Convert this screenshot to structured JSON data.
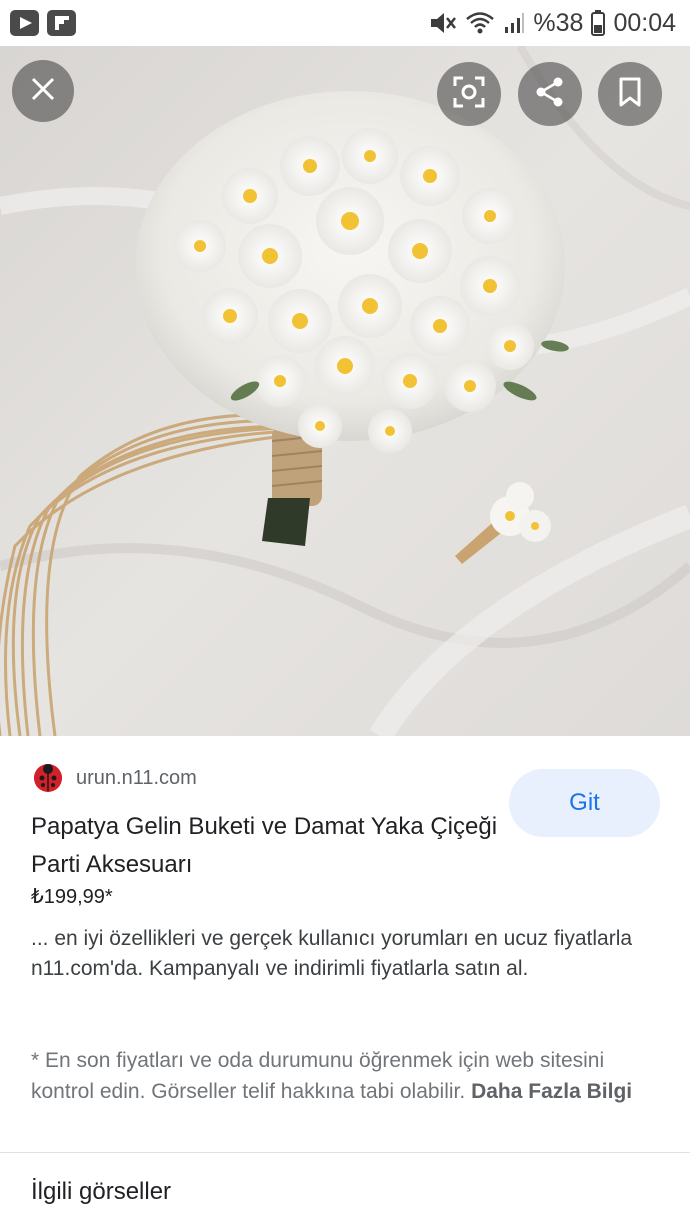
{
  "status_bar": {
    "battery": "%38",
    "time": "00:04",
    "icons": [
      "youtube-icon",
      "flipboard-icon",
      "mute-icon",
      "wifi-icon",
      "signal-icon",
      "battery-icon"
    ]
  },
  "viewer": {
    "icons": [
      "close-icon",
      "lens-icon",
      "share-icon",
      "bookmark-icon"
    ]
  },
  "result": {
    "source": "urun.n11.com",
    "go_label": "Git",
    "title": "Papatya Gelin Buketi ve Damat Yaka Çiçeği Parti Aksesuarı",
    "price": "₺199,99*",
    "description": "... en iyi özellikleri ve gerçek kullanıcı yorumları en ucuz fiyatlarla n11.com'da. Kampanyalı ve indirimli fiyatlarla satın al.",
    "disclaimer": "* En son fiyatları ve oda durumunu öğrenmek için web sitesini kontrol edin. Görseller telif hakkına tabi olabilir.",
    "more_info": "Daha Fazla Bilgi"
  },
  "related_heading": "İlgili görseller",
  "colors": {
    "accent": "#1a73e8",
    "button_bg": "#e8f0fe",
    "favicon": "#d3202a"
  }
}
